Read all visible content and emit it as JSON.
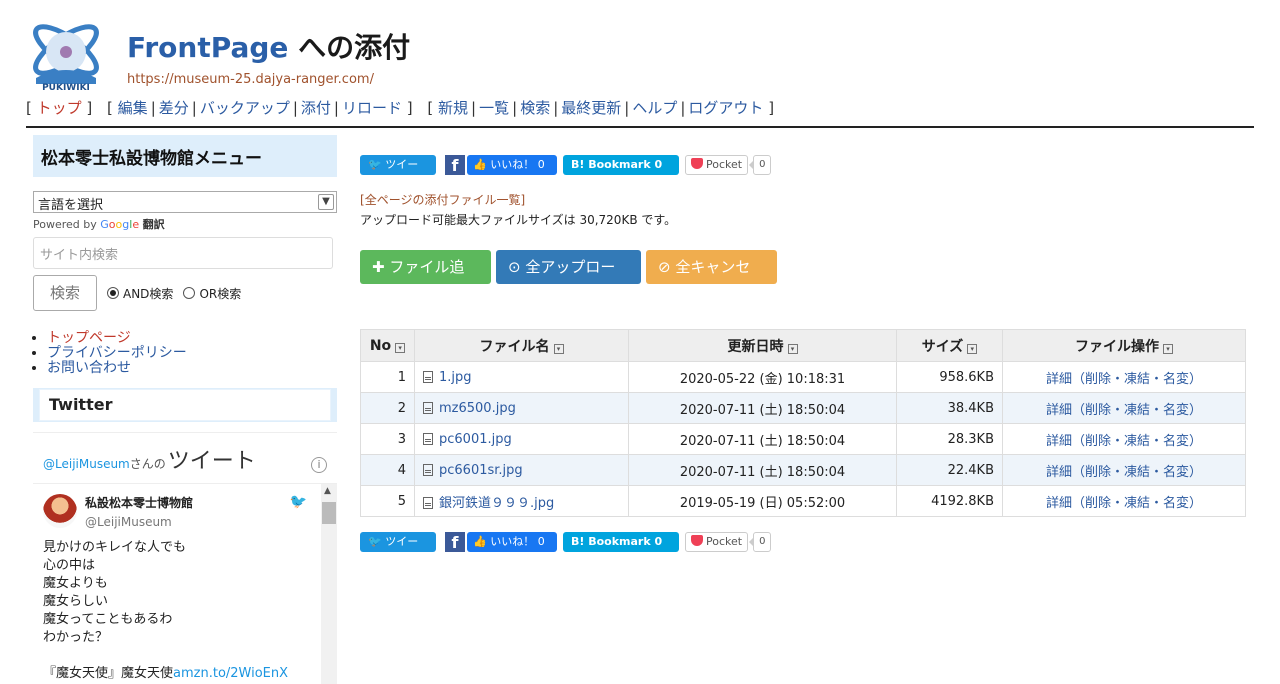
{
  "header": {
    "title_pg": "FrontPage",
    "title_suffix": " への添付",
    "url": "https://museum-25.dajya-ranger.com/",
    "logo_text": "PUKIWIKI"
  },
  "nav": {
    "group1": [
      "トップ"
    ],
    "group2": [
      "編集",
      "差分",
      "バックアップ",
      "添付",
      "リロード"
    ],
    "group3": [
      "新規",
      "一覧",
      "検索",
      "最終更新",
      "ヘルプ",
      "ログアウト"
    ]
  },
  "sidebar": {
    "menu_title": "松本零士私設博物館メニュー",
    "lang_select": "言語を選択",
    "powered_by": "Powered by",
    "google": [
      "G",
      "o",
      "o",
      "g",
      "l",
      "e"
    ],
    "translate": "翻訳",
    "search_placeholder": "サイト内検索",
    "search_button": "検索",
    "radio_and": "AND検索",
    "radio_or": "OR検索",
    "links": [
      "トップページ",
      "プライバシーポリシー",
      "お問い合わせ"
    ],
    "twitter_title": "Twitter",
    "timeline": {
      "user": "@LeijiMuseum",
      "san": "さんの",
      "tweet_word": "ツイート",
      "author_name": "私設松本零士博物館",
      "author_handle": "@LeijiMuseum",
      "lines": [
        "見かけのキレイな人でも",
        "心の中は",
        "魔女よりも",
        "魔女らしい",
        "魔女ってこともあるわ",
        "わかった？"
      ],
      "last_line_prefix": "『魔女天使』魔女天使",
      "last_line_link": "amzn.to/2WioEnX"
    }
  },
  "share": {
    "tweet": "ツイート",
    "like": "いいね！ 0",
    "bookmark": "B! Bookmark  0",
    "pocket": "Pocket",
    "pocket_count": "0",
    "fb": "f"
  },
  "main": {
    "attach_list_link": "全ページの添付ファイル一覧",
    "upload_info": "アップロード可能最大ファイルサイズは 30,720KB です。",
    "btn_add": "ファイル追加",
    "btn_upload": "全アップロード",
    "btn_cancel": "全キャンセル"
  },
  "table": {
    "headers": [
      "No",
      "ファイル名",
      "更新日時",
      "サイズ",
      "ファイル操作"
    ],
    "rows": [
      {
        "no": "1",
        "name": "1.jpg",
        "date": "2020-05-22 (金) 10:18:31",
        "size": "958.6KB",
        "ops": "詳細（削除・凍結・名変）"
      },
      {
        "no": "2",
        "name": "mz6500.jpg",
        "date": "2020-07-11 (土) 18:50:04",
        "size": "38.4KB",
        "ops": "詳細（削除・凍結・名変）"
      },
      {
        "no": "3",
        "name": "pc6001.jpg",
        "date": "2020-07-11 (土) 18:50:04",
        "size": "28.3KB",
        "ops": "詳細（削除・凍結・名変）"
      },
      {
        "no": "4",
        "name": "pc6601sr.jpg",
        "date": "2020-07-11 (土) 18:50:04",
        "size": "22.4KB",
        "ops": "詳細（削除・凍結・名変）"
      },
      {
        "no": "5",
        "name": "銀河鉄道９９９.jpg",
        "date": "2019-05-19 (日) 05:52:00",
        "size": "4192.8KB",
        "ops": "詳細（削除・凍結・名変）"
      }
    ]
  },
  "colors": {
    "accent": "#2a5fa8",
    "link": "#2c5aa0",
    "current": "#c0392b",
    "green": "#5cb85c",
    "blue": "#337ab7",
    "orange": "#f0ad4e"
  }
}
